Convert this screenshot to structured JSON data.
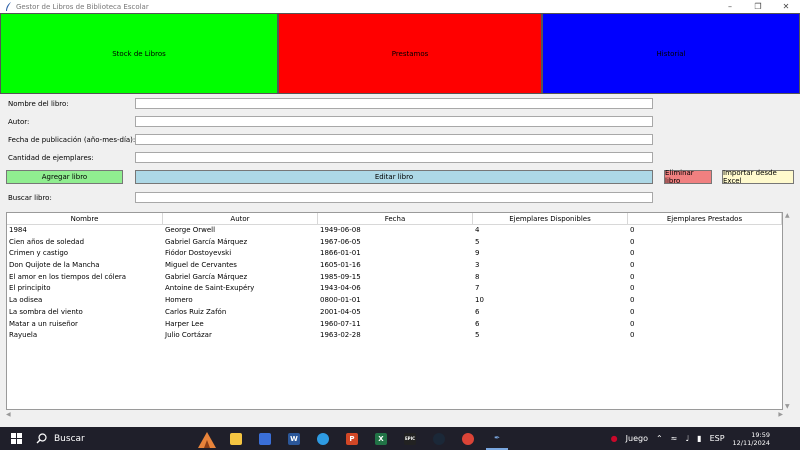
{
  "window": {
    "title": "Gestor de Libros de Biblioteca Escolar"
  },
  "nav": {
    "stock": {
      "label": "Stock de Libros",
      "color": "#00ff00"
    },
    "prestamos": {
      "label": "Prestamos",
      "color": "#ff0000"
    },
    "historial": {
      "label": "Historial",
      "color": "#0000ff"
    }
  },
  "form": {
    "nombre_label": "Nombre del libro:",
    "autor_label": "Autor:",
    "fecha_label": "Fecha de publicación (año-mes-día):",
    "cantidad_label": "Cantidad de ejemplares:",
    "buscar_label": "Buscar libro:"
  },
  "buttons": {
    "agregar": {
      "label": "Agregar libro",
      "color": "#90ee90"
    },
    "editar": {
      "label": "Editar libro",
      "color": "#add8e6"
    },
    "eliminar": {
      "label": "Eliminar libro",
      "color": "#f08080"
    },
    "importar": {
      "label": "Importar desde Excel",
      "color": "#fffacd"
    }
  },
  "table": {
    "columns": [
      "Nombre",
      "Autor",
      "Fecha",
      "Ejemplares Disponibles",
      "Ejemplares Prestados"
    ],
    "rows": [
      [
        "1984",
        "George Orwell",
        "1949-06-08",
        "4",
        "0"
      ],
      [
        "Cien años de soledad",
        "Gabriel García Márquez",
        "1967-06-05",
        "5",
        "0"
      ],
      [
        "Crimen y castigo",
        "Fiódor Dostoyevski",
        "1866-01-01",
        "9",
        "0"
      ],
      [
        "Don Quijote de la Mancha",
        "Miguel de Cervantes",
        "1605-01-16",
        "3",
        "0"
      ],
      [
        "El amor en los tiempos del cólera",
        "Gabriel García Márquez",
        "1985-09-15",
        "8",
        "0"
      ],
      [
        "El principito",
        "Antoine de Saint-Exupéry",
        "1943-04-06",
        "7",
        "0"
      ],
      [
        "La odisea",
        "Homero",
        "0800-01-01",
        "10",
        "0"
      ],
      [
        "La sombra del viento",
        "Carlos Ruiz Zafón",
        "2001-04-05",
        "6",
        "0"
      ],
      [
        "Matar a un ruiseñor",
        "Harper Lee",
        "1960-07-11",
        "6",
        "0"
      ],
      [
        "Rayuela",
        "Julio Cortázar",
        "1963-02-28",
        "5",
        "0"
      ]
    ]
  },
  "taskbar": {
    "search_label": "Buscar",
    "juego_label": "Juego",
    "lang": "ESP",
    "time": "19:59",
    "date": "12/11/2024"
  }
}
